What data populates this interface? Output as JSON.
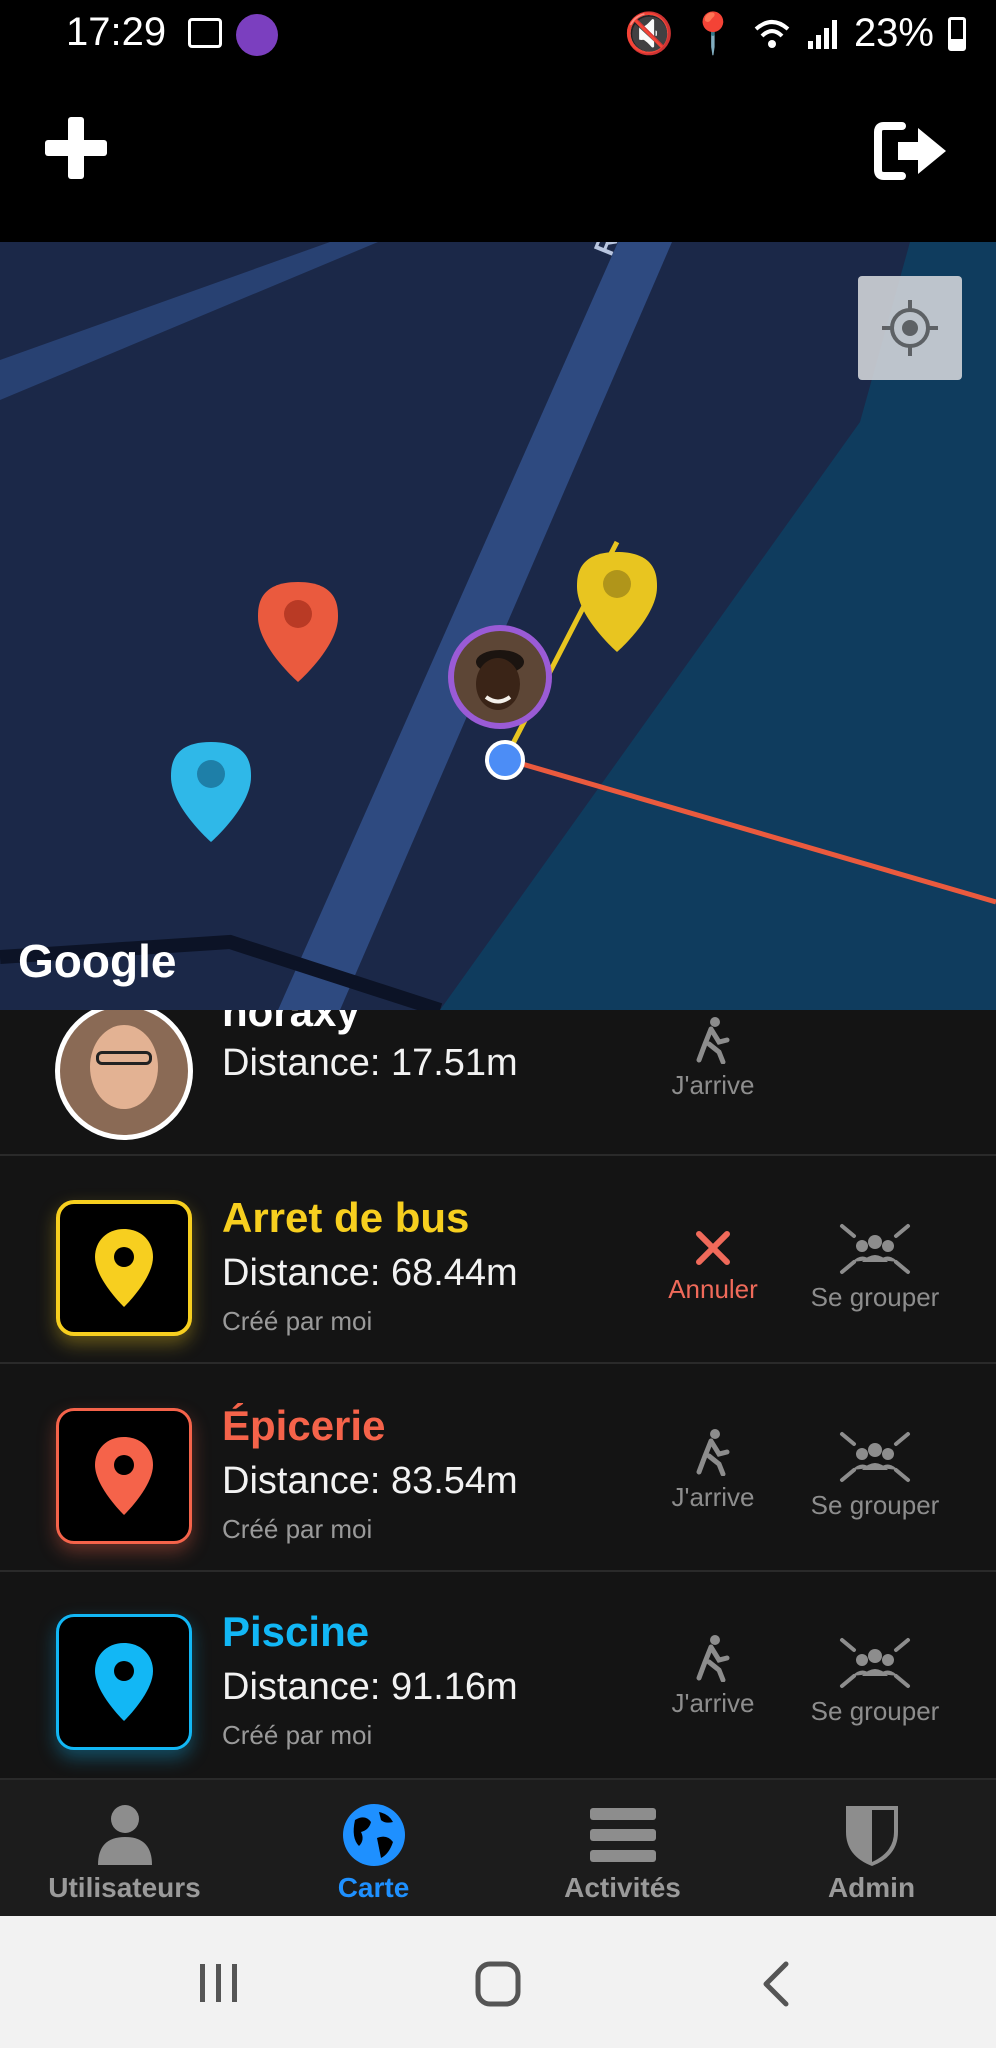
{
  "status_bar": {
    "time": "17:29",
    "battery": "23%"
  },
  "toolbar": {
    "add_icon": "plus-icon",
    "logout_icon": "logout-icon"
  },
  "map": {
    "street_label": "Rue d",
    "google_label": "Google",
    "locate_icon": "crosshair-icon",
    "colors": {
      "base": "#1b2848",
      "road": "#2e4a80",
      "water": "#0f3c5e",
      "yellow": "#e8c520",
      "red": "#ea5a3e",
      "blue": "#2fb8e8",
      "user_dot": "#4c8df6"
    }
  },
  "list": {
    "rows": [
      {
        "name": "noraxy",
        "distance": "Distance: 17.51m",
        "action_label": "J'arrive"
      },
      {
        "name": "Arret de bus",
        "distance": "Distance: 68.44m",
        "creator": "Créé par moi",
        "cancel_label": "Annuler",
        "group_label": "Se grouper",
        "color": "#f7cf1f"
      },
      {
        "name": "Épicerie",
        "distance": "Distance: 83.54m",
        "creator": "Créé par moi",
        "arrive_label": "J'arrive",
        "group_label": "Se grouper",
        "color": "#f5634a"
      },
      {
        "name": "Piscine",
        "distance": "Distance: 91.16m",
        "creator": "Créé par moi",
        "arrive_label": "J'arrive",
        "group_label": "Se grouper",
        "color": "#12b7f5"
      }
    ]
  },
  "bottom_nav": {
    "items": [
      {
        "label": "Utilisateurs",
        "icon": "user-icon"
      },
      {
        "label": "Carte",
        "icon": "globe-icon",
        "active": true
      },
      {
        "label": "Activités",
        "icon": "menu-icon"
      },
      {
        "label": "Admin",
        "icon": "shield-icon"
      }
    ],
    "active_color": "#1e90ff"
  },
  "system_nav": {
    "recents_icon": "recents-icon",
    "home_icon": "home-icon",
    "back_icon": "back-icon"
  }
}
